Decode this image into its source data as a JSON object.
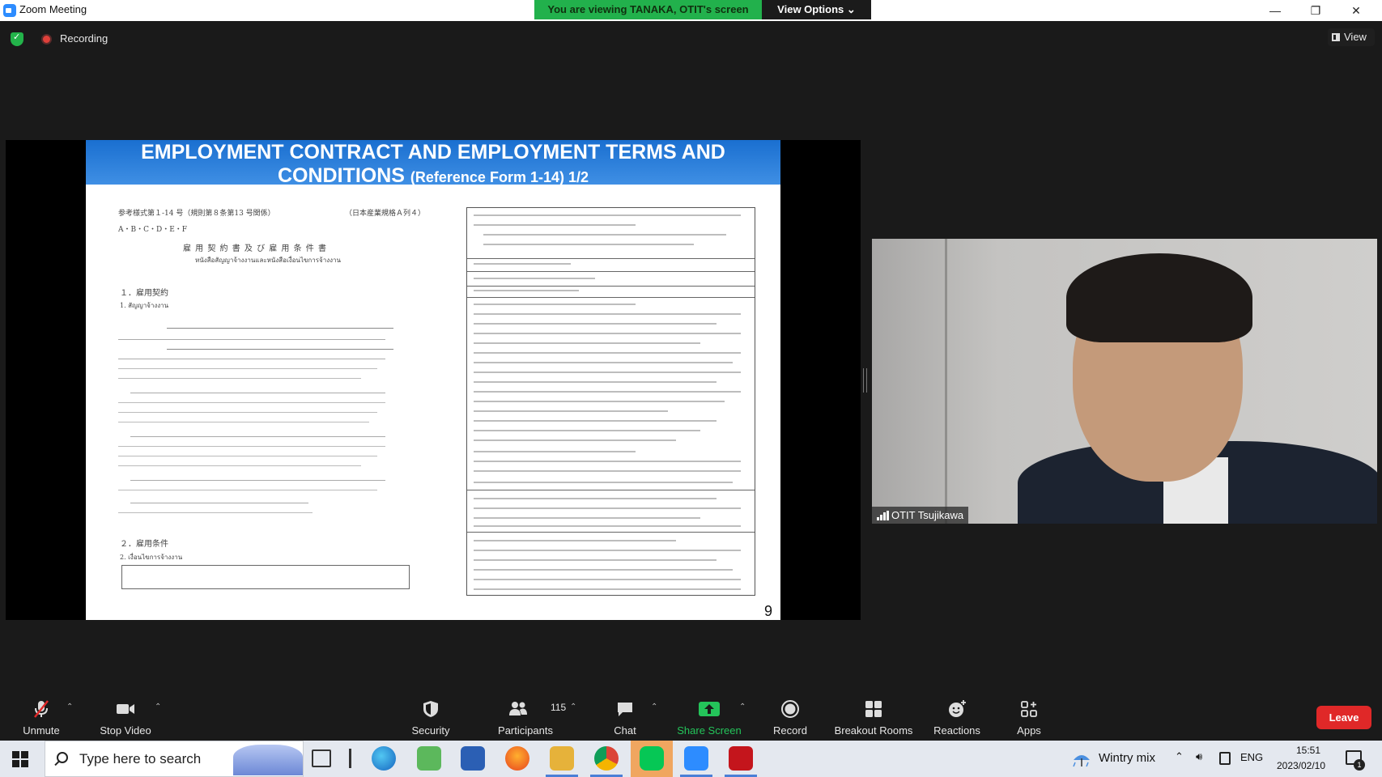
{
  "window": {
    "title": "Zoom Meeting",
    "banner": "You are viewing TANAKA, OTIT's screen",
    "view_options": "View Options"
  },
  "meeting_bar": {
    "recording_label": "Recording",
    "view_label": "View"
  },
  "slide": {
    "title_line1": "EMPLOYMENT CONTRACT AND EMPLOYMENT TERMS AND",
    "title_line2": "CONDITIONS",
    "title_sub": "(Reference Form 1-14)  1/2",
    "page_number": "9",
    "left_header_left": "参考様式第１-14 号（規則第８条第13 号関係）",
    "left_header_right": "（日本産業規格Ａ列４）",
    "grades": "A・B・C・D・E・F",
    "doc_title": "雇 用 契 約 書 及 び 雇 用 条 件 書",
    "doc_title_thai": "หนังสือสัญญาจ้างงานและหนังสือเงื่อนไขการจ้างงาน",
    "section1": "１．雇用契約",
    "section1_sub": "1. สัญญาจ้างงาน",
    "section2": "２．雇用条件",
    "section2_sub": "2. เงื่อนไขการจ้างงาน"
  },
  "video": {
    "participant_name": "OTIT Tsujikawa"
  },
  "toolbar": {
    "unmute": "Unmute",
    "stop_video": "Stop Video",
    "security": "Security",
    "participants": "Participants",
    "participants_count": "115",
    "chat": "Chat",
    "share_screen": "Share Screen",
    "record": "Record",
    "breakout_rooms": "Breakout Rooms",
    "reactions": "Reactions",
    "apps": "Apps",
    "leave": "Leave"
  },
  "taskbar": {
    "search_placeholder": "Type here to search",
    "weather": "Wintry mix",
    "language": "ENG",
    "time": "15:51",
    "date": "2023/02/10",
    "notifications": "1"
  },
  "colors": {
    "banner": "#22b14c",
    "share_accent": "#24c45a",
    "leave": "#e02828",
    "slide_header": "#2a7ad8"
  }
}
